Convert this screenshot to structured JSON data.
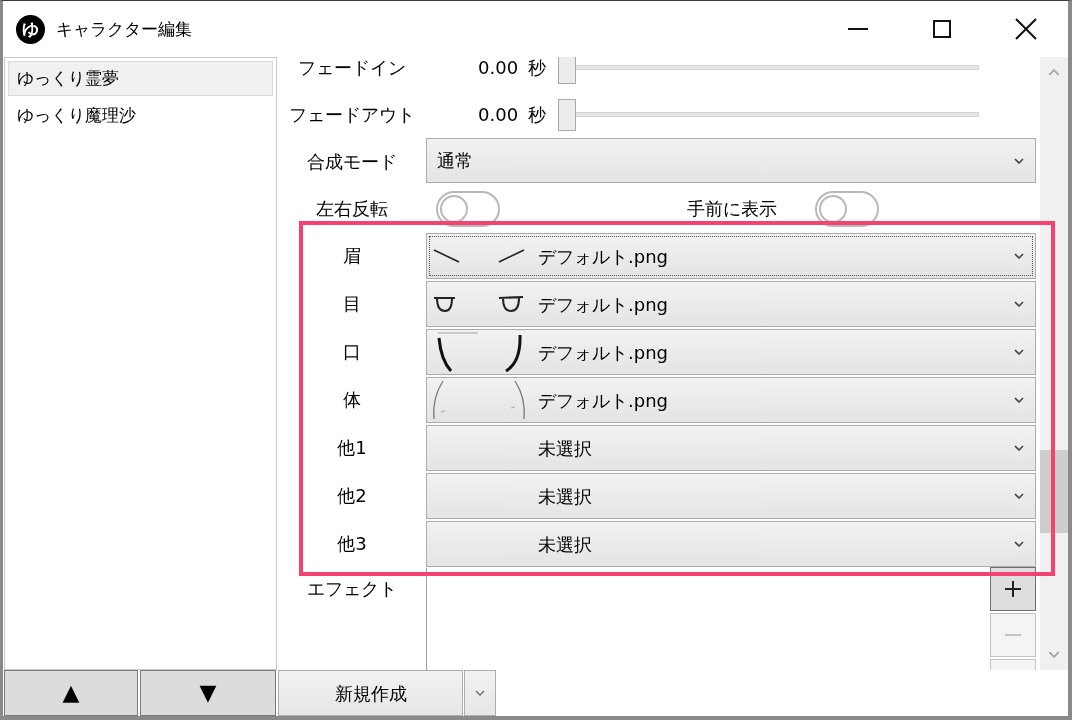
{
  "window": {
    "title": "キャラクター編集",
    "icon_text": "ゆ"
  },
  "characters": [
    {
      "name": "ゆっくり霊夢",
      "selected": true
    },
    {
      "name": "ゆっくり魔理沙",
      "selected": false
    }
  ],
  "fades": [
    {
      "label": "フェードイン",
      "value": "0.00",
      "unit": "秒",
      "level": 0
    },
    {
      "label": "フェードアウト",
      "value": "0.00",
      "unit": "秒",
      "level": 0
    }
  ],
  "blend_mode": {
    "label": "合成モード",
    "value": "通常"
  },
  "toggles": [
    {
      "label": "左右反転",
      "on": false
    },
    {
      "label": "手前に表示",
      "on": false
    }
  ],
  "parts": [
    {
      "label": "眉",
      "kind": "eyebrows",
      "value": "デフォルト.png",
      "focused": true
    },
    {
      "label": "目",
      "kind": "eyes",
      "value": "デフォルト.png",
      "focused": false
    },
    {
      "label": "口",
      "kind": "mouth",
      "value": "デフォルト.png",
      "focused": false
    },
    {
      "label": "体",
      "kind": "body",
      "value": "デフォルト.png",
      "focused": false
    },
    {
      "label": "他1",
      "kind": "empty",
      "value": "未選択",
      "focused": false
    },
    {
      "label": "他2",
      "kind": "empty",
      "value": "未選択",
      "focused": false
    },
    {
      "label": "他3",
      "kind": "empty",
      "value": "未選択",
      "focused": false
    }
  ],
  "effects": {
    "label": "エフェクト",
    "buttons": [
      {
        "kind": "add",
        "disabled": false
      },
      {
        "kind": "remove",
        "disabled": true
      }
    ]
  },
  "list_buttons": [
    "▲",
    "▼"
  ],
  "new_button": {
    "label": "新規作成"
  }
}
